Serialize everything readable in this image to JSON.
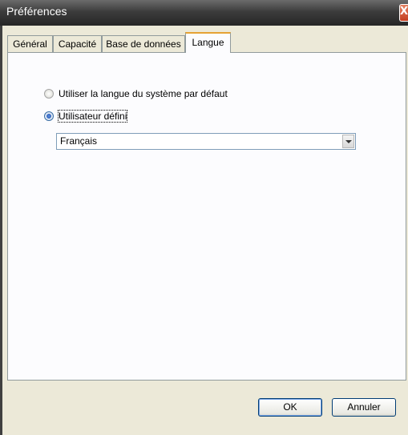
{
  "window": {
    "title": "Préférences",
    "close_glyph": "X"
  },
  "tabs": [
    {
      "label": "Général",
      "active": false
    },
    {
      "label": "Capacité",
      "active": false
    },
    {
      "label": "Base de données",
      "active": false
    },
    {
      "label": "Langue",
      "active": true
    }
  ],
  "language": {
    "option_system": "Utiliser la langue du système par défaut",
    "option_custom": "Utilisateur défini",
    "selected_option": "custom",
    "dropdown_value": "Français"
  },
  "buttons": {
    "ok": "OK",
    "cancel": "Annuler"
  },
  "colors": {
    "titlebar": "#3c3c3c",
    "active_tab_accent": "#e6a234",
    "dialog_bg": "#ece9d8"
  }
}
